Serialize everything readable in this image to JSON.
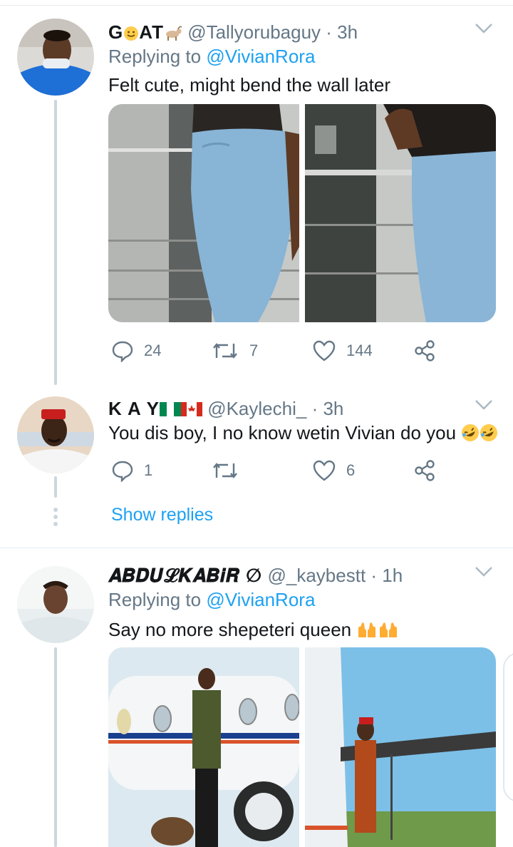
{
  "tweets": [
    {
      "name_prefix": "G",
      "name_mid": "AT",
      "handle": "@Tallyorubaguy",
      "time": "· 3h",
      "replying_prefix": "Replying to",
      "replying_to": "@VivianRora",
      "text": "Felt cute, might bend the wall later",
      "replies": "24",
      "retweets": "7",
      "likes": "144"
    },
    {
      "name": "K A Y",
      "handle": "@Kaylechi_",
      "time": "· 3h",
      "text": "You dis boy, I no know wetin Vivian do you",
      "replies": "1",
      "retweets": "",
      "likes": "6",
      "show_replies": "Show replies"
    },
    {
      "name": "𝑨𝑩𝑫𝑼𝓛𝑲𝑨𝑩𝒊𝑹 ∅",
      "handle": "@_kaybestt",
      "time": "· 1h",
      "replying_prefix": "Replying to",
      "replying_to": "@VivianRora",
      "text": "Say no more shepeteri queen"
    }
  ],
  "icons": {
    "reply": "reply-icon",
    "retweet": "retweet-icon",
    "like": "heart-icon",
    "share": "share-icon",
    "more": "chevron-down-icon"
  },
  "colors": {
    "accent": "#1da1f2",
    "secondary_text": "#657786",
    "thread_line": "#ccd6dd"
  }
}
